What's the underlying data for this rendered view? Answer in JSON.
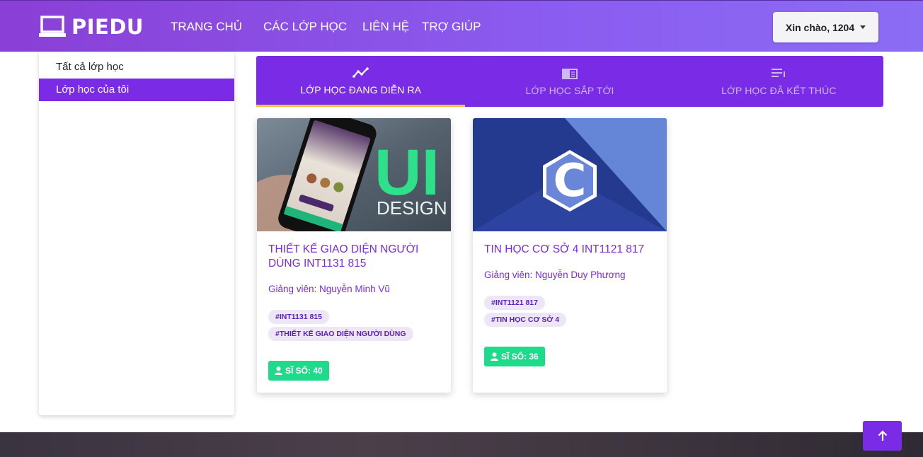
{
  "app": {
    "logo_text": "PIEDU"
  },
  "nav": {
    "items": [
      {
        "label": "TRANG CHỦ"
      },
      {
        "label": "CÁC LỚP HỌC"
      },
      {
        "label": "LIÊN HỆ"
      },
      {
        "label": "TRỢ GIÚP"
      }
    ],
    "greeting": "Xin chào, 1204"
  },
  "sidebar": {
    "items": [
      {
        "label": "Tất cả lớp học"
      },
      {
        "label": "Lớp học của tôi"
      }
    ]
  },
  "tabs": [
    {
      "label": "LỚP HỌC ĐANG DIỄN RA"
    },
    {
      "label": "LỚP HỌC SẮP TỚI"
    },
    {
      "label": "LỚP HỌC ĐÃ KẾT THÚC"
    }
  ],
  "cards": [
    {
      "image_text_1": "UI",
      "image_text_2": "DESIGN",
      "title": "THIẾT KẾ GIAO DIỆN NGƯỜI DÙNG INT1131 815",
      "teacher": "Giảng viên: Nguyễn Minh Vũ",
      "tags": [
        "#INT1131 815",
        "#THIẾT KẾ GIAO DIỆN NGƯỜI DÙNG"
      ],
      "count": "SĨ SỐ: 40"
    },
    {
      "image_text_1": "C",
      "title": "TIN HỌC CƠ SỞ 4 INT1121 817",
      "teacher": "Giảng viên: Nguyễn Duy Phương",
      "tags": [
        "#INT1121 817",
        "#TIN HỌC CƠ SỞ 4"
      ],
      "count": "SĨ SỐ: 36"
    }
  ],
  "colors": {
    "primary": "#7a2be6",
    "accent_underline": "#f4c23c",
    "count_badge": "#1edb8b",
    "tag_bg": "#ece6f7"
  },
  "icons": {
    "logo": "laptop-icon",
    "tab_1": "trending-line-icon",
    "tab_2": "book-open-icon",
    "tab_3": "list-icon",
    "count": "user-icon",
    "scroll_top": "arrow-up-icon"
  }
}
